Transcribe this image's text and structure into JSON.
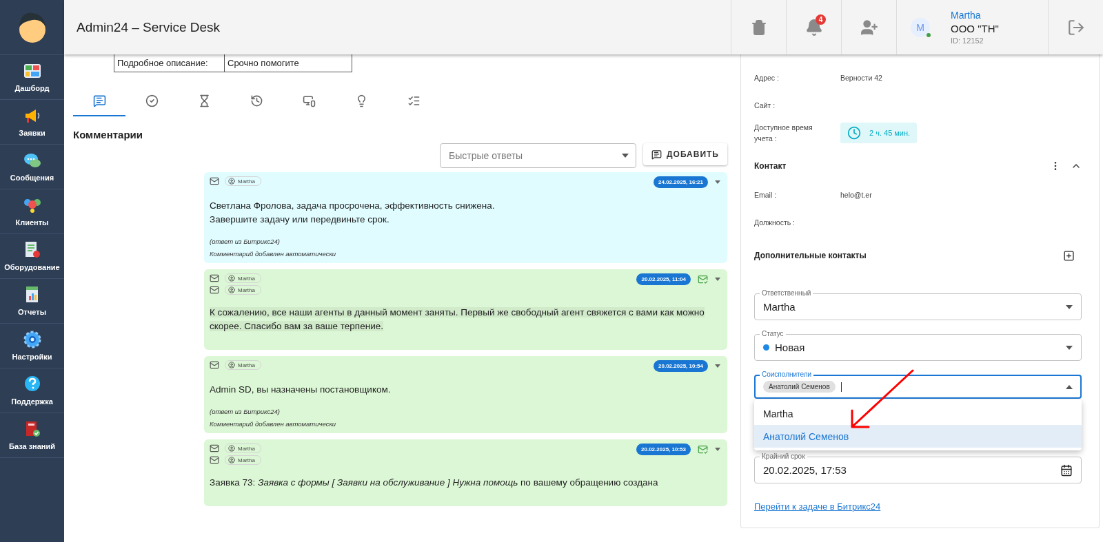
{
  "header": {
    "title": "Admin24 – Service Desk",
    "notifications": "4",
    "user": {
      "initial": "M",
      "online": true,
      "name": "Martha",
      "company": "ООО \"ТН\"",
      "id": "ID: 12152"
    }
  },
  "sidebar": {
    "items": [
      {
        "label": "Дашборд"
      },
      {
        "label": "Заявки"
      },
      {
        "label": "Сообщения"
      },
      {
        "label": "Клиенты"
      },
      {
        "label": "Оборудование"
      },
      {
        "label": "Отчеты"
      },
      {
        "label": "Настройки"
      },
      {
        "label": "Поддержка"
      },
      {
        "label": "База знаний"
      }
    ]
  },
  "description": {
    "label": "Подробное описание:",
    "value": "Срочно помогите"
  },
  "tabs": [
    {
      "selected": true
    },
    {
      "selected": false
    },
    {
      "selected": false
    },
    {
      "selected": false
    },
    {
      "selected": false
    },
    {
      "selected": false
    },
    {
      "selected": false
    }
  ],
  "comments_title": "Комментарии",
  "quick_replies": {
    "placeholder": "Быстрые ответы"
  },
  "add_button": "ДОБАВИТЬ",
  "comments": [
    {
      "color": "#e0fcff",
      "senders": [
        "Martha"
      ],
      "date": "24.02.2025, 16:21",
      "delivered": false,
      "highlighted": false,
      "body": [
        "Светлана Фролова, задача просрочена, эффективность снижена.",
        "Завершите задачу или передвиньте срок."
      ],
      "notes": [
        "(ответ из Битрикс24)",
        "Комментарий добавлен автоматически"
      ]
    },
    {
      "color": "#dcf7d5",
      "senders": [
        "Martha",
        "Martha"
      ],
      "date": "20.02.2025, 11:04",
      "delivered": true,
      "highlighted": true,
      "body": [
        "К сожалению, все наши агенты в данный момент заняты. Первый же свободный агент свяжется с вами как можно скорее. Спасибо вам за ваше терпение."
      ]
    },
    {
      "color": "#dcf7d5",
      "senders": [
        "Martha"
      ],
      "date": "20.02.2025, 10:54",
      "delivered": false,
      "highlighted": false,
      "body": [
        "Admin SD, вы назначены постановщиком."
      ],
      "notes": [
        "(ответ из Битрикс24)",
        "Комментарий добавлен автоматически"
      ]
    },
    {
      "color": "#dcf7d5",
      "senders": [
        "Martha",
        "Martha"
      ],
      "date": "20.02.2025, 10:53",
      "delivered": true,
      "highlighted": false,
      "body": [
        "Заявка 73: *Заявка с формы [ Заявки на обслуживание ] Нужна помощь* по вашему обращению создана"
      ]
    }
  ],
  "details": {
    "rows": [
      {
        "label": "Адрес :",
        "value": "Верности 42"
      },
      {
        "label": "Сайт :"
      }
    ],
    "time": {
      "label": "Доступное время учета :",
      "value": "2 ч. 45 мин."
    },
    "contact": {
      "title": "Контакт",
      "expanded": true,
      "rows": [
        {
          "label": "Email :",
          "value": "helo@t.er"
        },
        {
          "label": "Должность :"
        }
      ]
    },
    "extra_contacts": "Дополнительные контакты",
    "responsible": {
      "label": "Ответственный",
      "value": "Martha"
    },
    "status": {
      "label": "Статус",
      "value": "Новая",
      "color": "#1e88e5"
    },
    "coexecutors": {
      "label": "Соисполнители",
      "chips": [
        "Анатолий Семенов"
      ],
      "open": true,
      "options": [
        {
          "label": "Martha",
          "selected": false
        },
        {
          "label": "Анатолий Семенов",
          "selected": true
        }
      ]
    },
    "deadline": {
      "label": "Крайний срок",
      "value": "20.02.2025, 17:53"
    },
    "link": "Перейти к задаче в Битрикс24"
  }
}
